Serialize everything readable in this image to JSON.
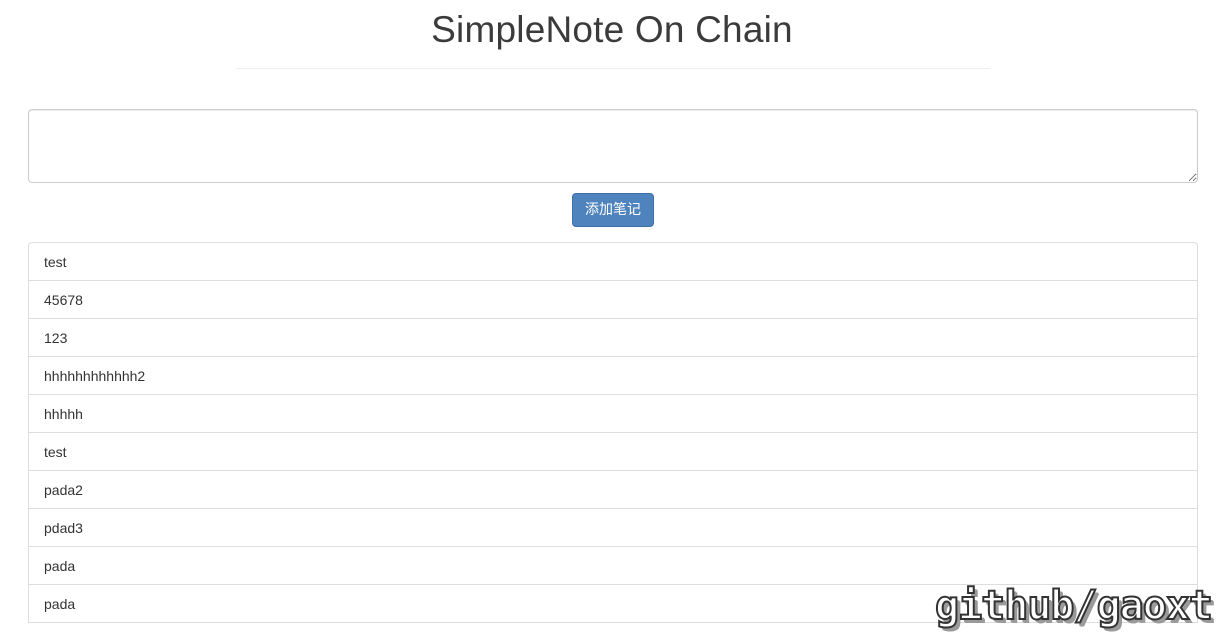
{
  "header": {
    "title": "SimpleNote On Chain"
  },
  "composer": {
    "textarea_value": "",
    "textarea_placeholder": "",
    "add_button_label": "添加笔记"
  },
  "notes": [
    "test",
    "45678",
    "123",
    "hhhhhhhhhhhh2",
    "hhhhh",
    "test",
    "pada2",
    "pdad3",
    "pada",
    "pada"
  ],
  "watermark": {
    "text": "github/gaoxt"
  },
  "colors": {
    "button_primary": "#4f83bd",
    "text": "#333333",
    "border": "#dddddd"
  }
}
